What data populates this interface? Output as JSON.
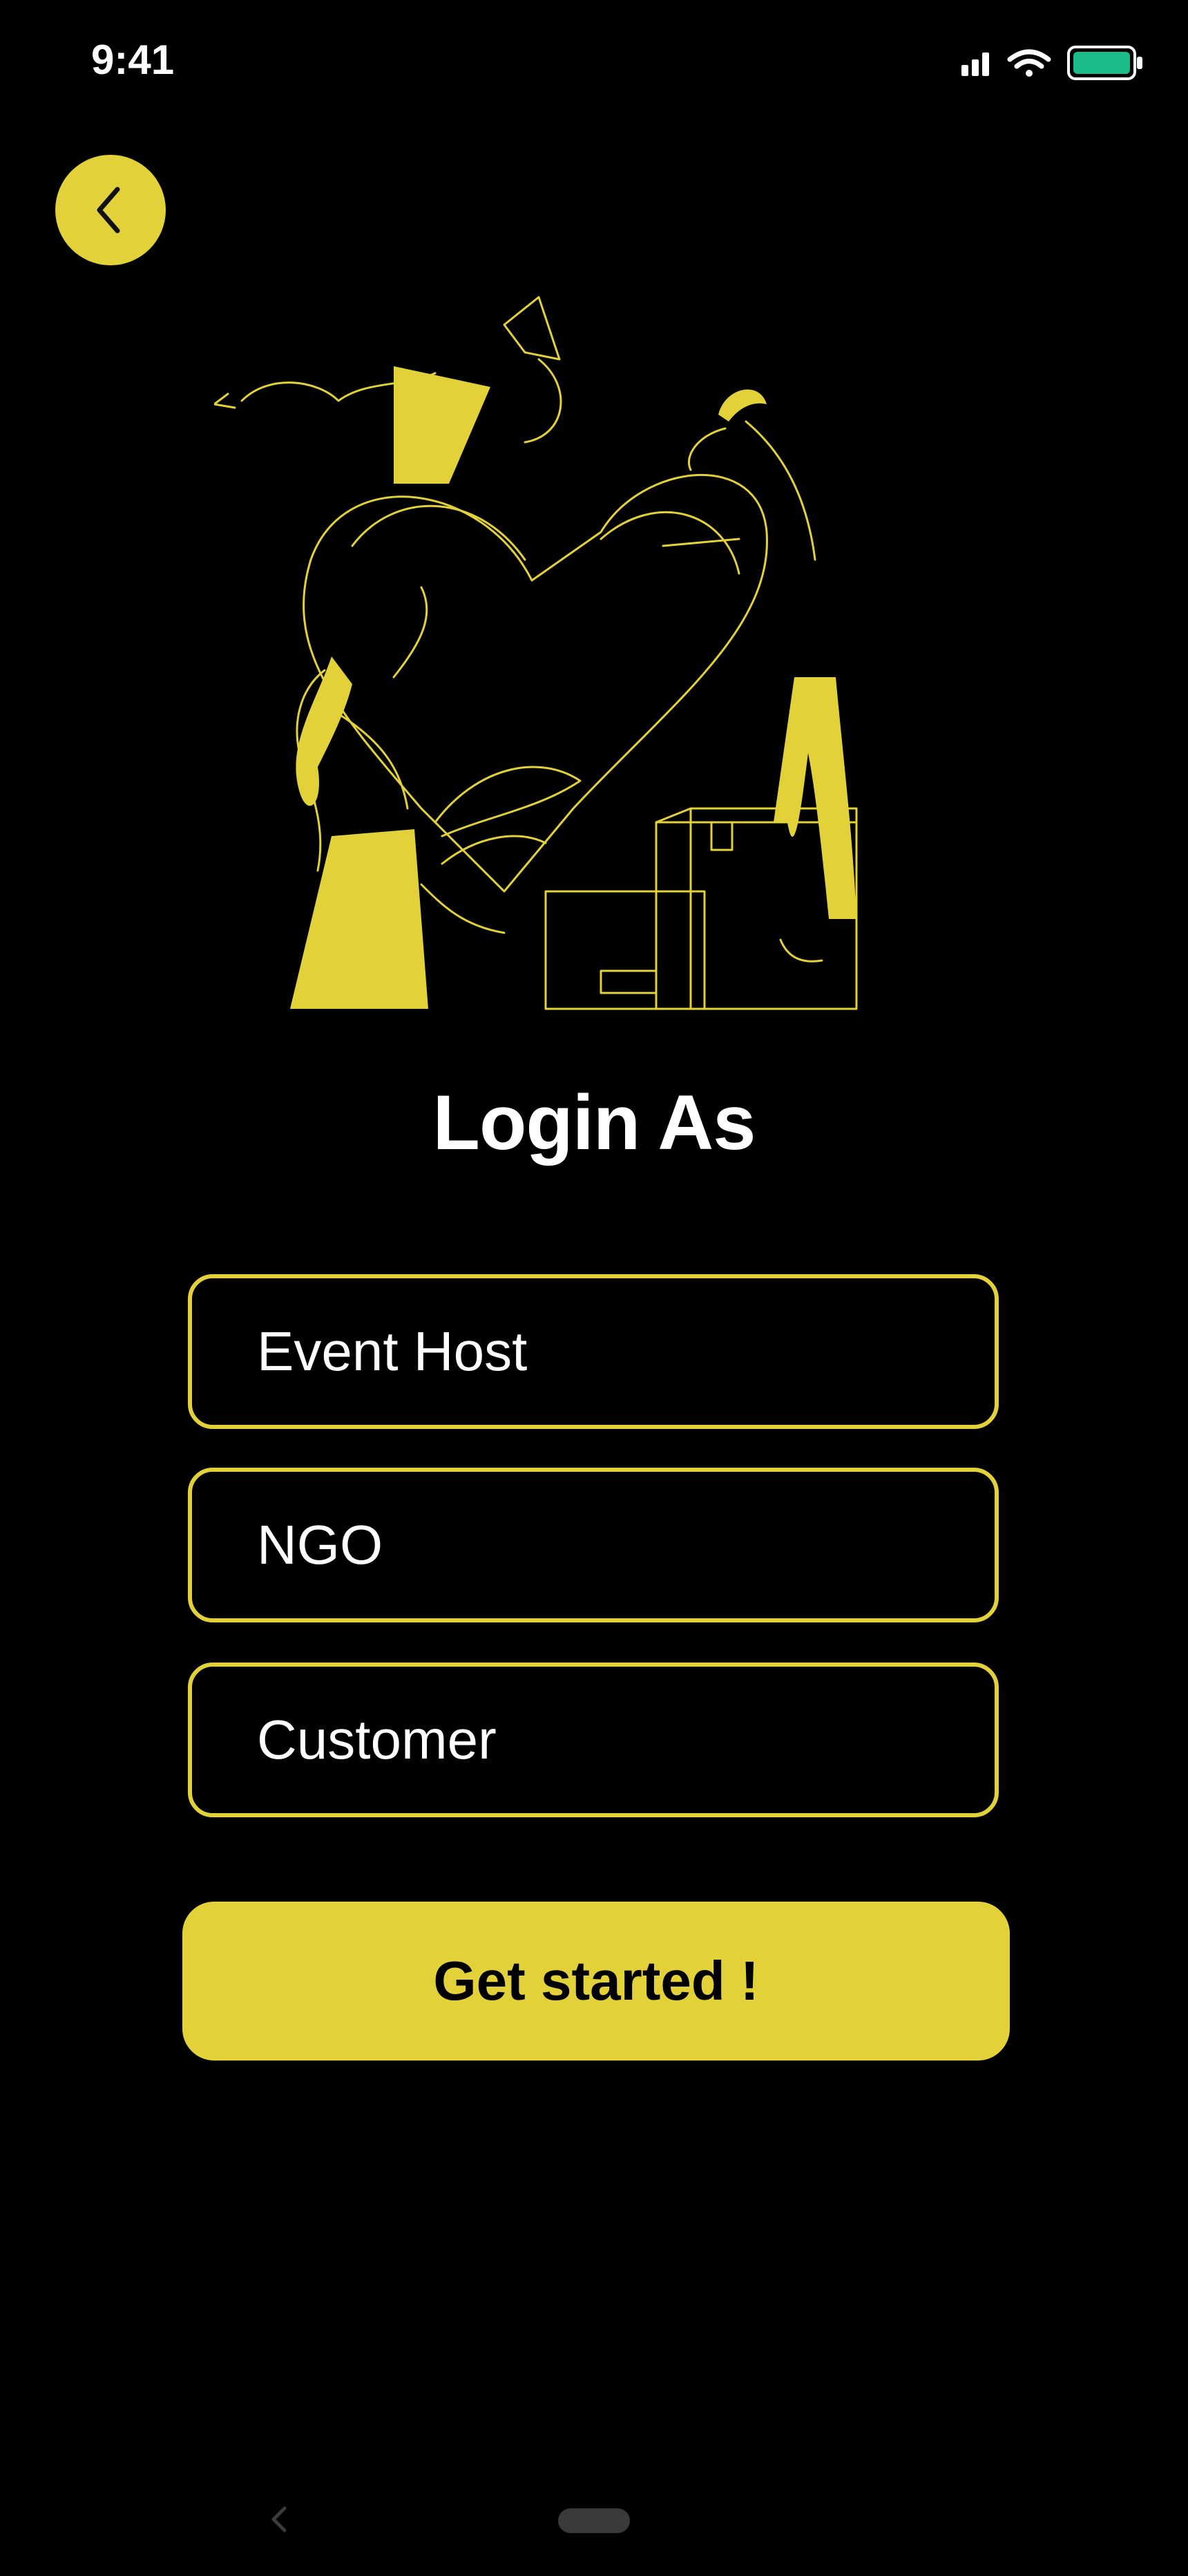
{
  "status_bar": {
    "time": "9:41"
  },
  "header": {
    "back_icon": "chevron-left-icon"
  },
  "main": {
    "title": "Login As",
    "options": [
      {
        "label": "Event Host"
      },
      {
        "label": "NGO"
      },
      {
        "label": "Customer"
      }
    ],
    "cta_label": "Get started !"
  },
  "colors": {
    "accent": "#E2D138",
    "background": "#000000",
    "battery": "#1ABC8A"
  }
}
